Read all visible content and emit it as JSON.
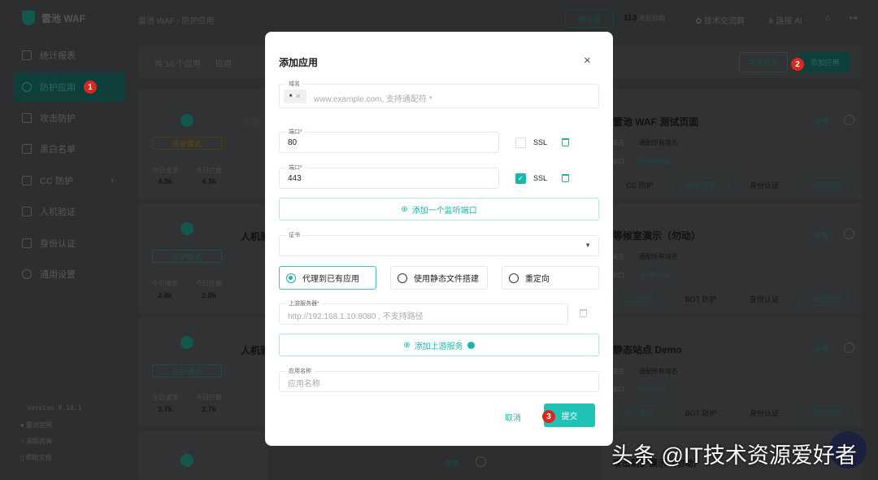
{
  "app": {
    "name": "雷池 WAF"
  },
  "breadcrumb": [
    "雷池 WAF",
    "防护应用"
  ],
  "header": {
    "edition": "商业版",
    "days": "113",
    "days_label": "天后到期",
    "community": "技术交流群",
    "ai": "连接 AI"
  },
  "sidebar": {
    "items": [
      {
        "label": "统计报表"
      },
      {
        "label": "防护应用",
        "badge": "1"
      },
      {
        "label": "攻击防护"
      },
      {
        "label": "黑白名单"
      },
      {
        "label": "CC 防护"
      },
      {
        "label": "人机验证"
      },
      {
        "label": "身份认证"
      },
      {
        "label": "通用设置"
      }
    ],
    "version": "Version 8.18.1",
    "links": [
      "雷池官网",
      "采购咨询",
      "帮助文档"
    ]
  },
  "toolbar": {
    "count": "共 16 个应用",
    "filter": "应用",
    "advanced": "高级配置",
    "add": "添加应用",
    "add_badge": "2"
  },
  "left_cards": [
    {
      "mode": "观察模式",
      "req_label": "今日请求",
      "req": "4.3k",
      "block_label": "今日拦截",
      "block": "4.3k",
      "title": "示例"
    },
    {
      "mode": "防护模式",
      "req_label": "今日请求",
      "req": "2.8k",
      "block_label": "今日拦截",
      "block": "2.8k",
      "title": "人机验"
    },
    {
      "mode": "防护模式",
      "req_label": "今日请求",
      "req": "2.7k",
      "block_label": "今日拦截",
      "block": "2.7k",
      "title": "人机验"
    }
  ],
  "right_cards": [
    {
      "title": "雷池 WAF 测试页面",
      "domain_label": "域名",
      "domain": "通配所有域名",
      "port_label": "端口",
      "port": "22443/SSL",
      "detail": "详情",
      "tags": [
        "CC 防护",
        "BOT 防护",
        "身份认证",
        "攻击防护"
      ]
    },
    {
      "title": "等候室演示（勿动）",
      "domain_label": "域名",
      "domain": "通配所有域名",
      "port_label": "端口",
      "port": "10087/SSL",
      "detail": "详情",
      "tags": [
        "CC 防护",
        "BOT 防护",
        "身份认证",
        "攻击防护"
      ]
    },
    {
      "title": "静态站点 Demo",
      "domain_label": "域名",
      "domain": "通配所有域名",
      "port_label": "端口",
      "port": "8009/SSL",
      "detail": "详情",
      "tags": [
        "CC 防护",
        "BOT 防护",
        "身份认证",
        "攻击防护"
      ]
    },
    {
      "title": "攻击防护演示（勿动）",
      "detail": "详情"
    }
  ],
  "modal": {
    "title": "添加应用",
    "domain_label": "域名",
    "domain_tag": "*",
    "domain_placeholder": "www.example.com, 支持通配符 *",
    "port_label": "端口",
    "ports": [
      {
        "value": "80",
        "ssl": false
      },
      {
        "value": "443",
        "ssl": true
      }
    ],
    "ssl_label": "SSL",
    "add_port": "添加一个监听端口",
    "cert_label": "证书",
    "modes": [
      "代理到已有应用",
      "使用静态文件搭建",
      "重定向"
    ],
    "selected_mode": 0,
    "upstream_label": "上游服务器",
    "upstream_placeholder": "http://192.168.1.10:8080 , 不支持路径",
    "add_upstream": "添加上游服务",
    "name_label": "应用名称",
    "name_placeholder": "应用名称",
    "cancel": "取消",
    "submit": "提交",
    "submit_badge": "3"
  },
  "watermark": "头条 @IT技术资源爱好者",
  "colors": {
    "accent": "#1bb5aa",
    "badge": "#d8291f"
  }
}
